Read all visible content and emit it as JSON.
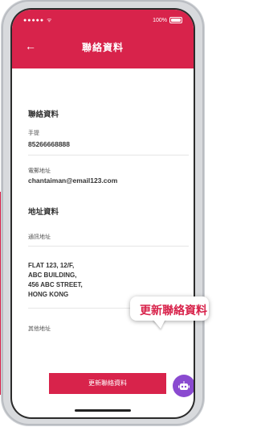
{
  "status_bar": {
    "signal": "●●●●● ᯤ",
    "battery_text": "100%"
  },
  "header": {
    "title": "聯絡資料",
    "back_icon": "back-arrow-icon"
  },
  "contact": {
    "section_title": "聯絡資料",
    "phone_label": "手提",
    "phone_value": "85266668888",
    "email_label": "電郵地址",
    "email_value": "chantaiman@email123.com"
  },
  "address": {
    "section_title": "地址資料",
    "mailing_label": "通訊地址",
    "mailing_lines": [
      "FLAT 123, 12/F,",
      "ABC BUILDING,",
      "456 ABC STREET,",
      "HONG KONG"
    ],
    "other_label": "其他地址"
  },
  "actions": {
    "update_label": "更新聯絡資料"
  },
  "callout": {
    "text": "更新聯絡資料"
  },
  "colors": {
    "brand": "#d8234b",
    "chat": "#8a4ad0"
  }
}
